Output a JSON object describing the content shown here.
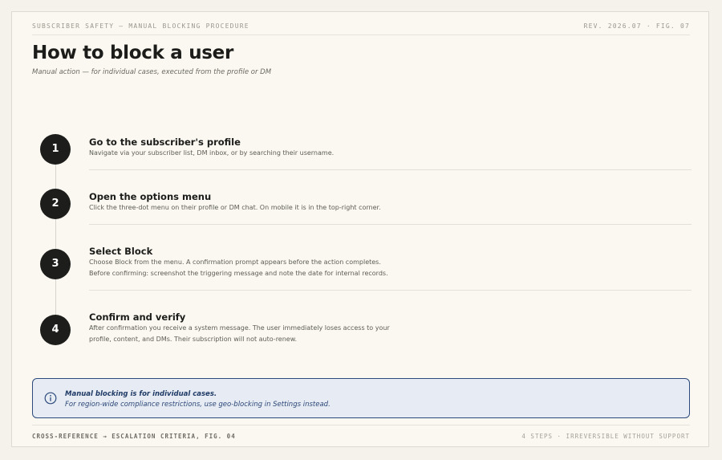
{
  "header": {
    "left": "SUBSCRIBER SAFETY — MANUAL BLOCKING PROCEDURE",
    "right": "REV. 2026.07 · FIG. 07"
  },
  "title": "How to block a user",
  "subtitle": "Manual action — for individual cases, executed from the profile or DM",
  "steps": [
    {
      "number": "1",
      "title": "Go to the subscriber's profile",
      "lines": [
        "Navigate via your subscriber list, DM inbox, or by searching their username."
      ]
    },
    {
      "number": "2",
      "title": "Open the options menu",
      "lines": [
        "Click the three-dot menu on their profile or DM chat. On mobile it is in the top-right corner."
      ]
    },
    {
      "number": "3",
      "title": "Select Block",
      "lines": [
        "Choose Block from the menu. A confirmation prompt appears before the action completes.",
        "Before confirming: screenshot the triggering message and note the date for internal records."
      ]
    },
    {
      "number": "4",
      "title": "Confirm and verify",
      "lines": [
        "After confirmation you receive a system message. The user immediately loses access to your",
        "profile, content, and DMs. Their subscription will not auto-renew."
      ]
    }
  ],
  "callout": {
    "icon": "info-icon",
    "strong": "Manual blocking is for individual cases.",
    "text": "For region-wide compliance restrictions, use geo-blocking in Settings instead."
  },
  "footer": {
    "left": "CROSS-REFERENCE → ESCALATION CRITERIA, FIG. 04",
    "right": "4 STEPS · IRREVERSIBLE WITHOUT SUPPORT"
  },
  "colors": {
    "background": "#faf8f0",
    "ink": "#1c1c1a",
    "callout_bg": "#e7ecf4",
    "callout_border": "#2c4a7c"
  }
}
